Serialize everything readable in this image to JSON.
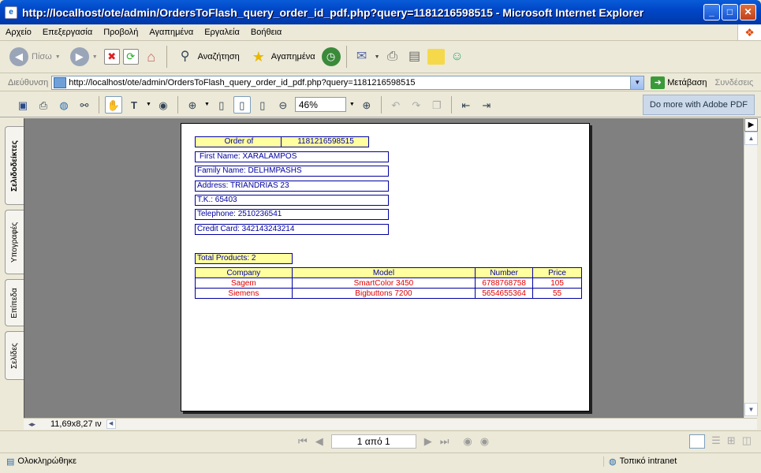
{
  "window": {
    "title": "http://localhost/ote/admin/OrdersToFlash_query_order_id_pdf.php?query=1181216598515 - Microsoft Internet Explorer"
  },
  "menu": [
    "Αρχείο",
    "Επεξεργασία",
    "Προβολή",
    "Αγαπημένα",
    "Εργαλεία",
    "Βοήθεια"
  ],
  "toolbar": {
    "back_label": "Πίσω",
    "search_label": "Αναζήτηση",
    "favorites_label": "Αγαπημένα"
  },
  "address": {
    "label": "Διεύθυνση",
    "url": "http://localhost/ote/admin/OrdersToFlash_query_order_id_pdf.php?query=1181216598515",
    "go_label": "Μετάβαση",
    "links_label": "Συνδέσεις"
  },
  "pdf_toolbar": {
    "zoom": "46%",
    "adobe_label": "Do more with Adobe PDF"
  },
  "side_tabs": [
    "Σελιδοδείκτες",
    "Υπογραφές",
    "Επίπεδα",
    "Σελίδες"
  ],
  "page_size": "11,69x8,27 ιν",
  "navigation": {
    "page_indicator": "1 από 1"
  },
  "status": {
    "left": "Ολοκληρώθηκε",
    "right": "Τοπικό intranet"
  },
  "document": {
    "order_label": "Order of",
    "order_id": "1181216598515",
    "first_name": "First Name: XARALAMPOS",
    "family_name": "Family Name: DELHMPASHS",
    "address": "Address: TRIANDRIAS 23",
    "tk": "T.K.: 65403",
    "telephone": "Telephone: 2510236541",
    "credit_card": "Credit Card: 342143243214",
    "total_products": "Total Products: 2",
    "columns": [
      "Company",
      "Model",
      "Number",
      "Price"
    ],
    "rows": [
      [
        "Sagem",
        "SmartColor 3450",
        "6788768758",
        "105"
      ],
      [
        "Siemens",
        "Bigbuttons 7200",
        "5654655364",
        "55"
      ]
    ]
  }
}
